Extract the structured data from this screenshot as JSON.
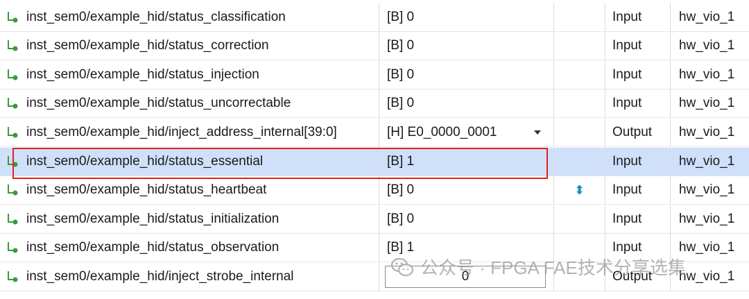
{
  "rows": [
    {
      "name": "inst_sem0/example_hid/status_classification",
      "value": "[B] 0",
      "direction": "Input",
      "vio": "hw_vio_1"
    },
    {
      "name": "inst_sem0/example_hid/status_correction",
      "value": "[B] 0",
      "direction": "Input",
      "vio": "hw_vio_1"
    },
    {
      "name": "inst_sem0/example_hid/status_injection",
      "value": "[B] 0",
      "direction": "Input",
      "vio": "hw_vio_1"
    },
    {
      "name": "inst_sem0/example_hid/status_uncorrectable",
      "value": "[B] 0",
      "direction": "Input",
      "vio": "hw_vio_1"
    },
    {
      "name": "inst_sem0/example_hid/inject_address_internal[39:0]",
      "value": "[H] E0_0000_0001",
      "direction": "Output",
      "vio": "hw_vio_1"
    },
    {
      "name": "inst_sem0/example_hid/status_essential",
      "value": "[B] 1",
      "direction": "Input",
      "vio": "hw_vio_1"
    },
    {
      "name": "inst_sem0/example_hid/status_heartbeat",
      "value": "[B] 0",
      "direction": "Input",
      "vio": "hw_vio_1",
      "activity": "⬍"
    },
    {
      "name": "inst_sem0/example_hid/status_initialization",
      "value": "[B] 0",
      "direction": "Input",
      "vio": "hw_vio_1"
    },
    {
      "name": "inst_sem0/example_hid/status_observation",
      "value": "[B] 1",
      "direction": "Input",
      "vio": "hw_vio_1"
    },
    {
      "name": "inst_sem0/example_hid/inject_strobe_internal",
      "value": "0",
      "direction": "Output",
      "vio": "hw_vio_1"
    }
  ],
  "selected_row": 6,
  "watermark": "公众号 · FPGA FAE技术分享选集",
  "colors": {
    "selection": "#cfe0fa",
    "highlight_border": "#e41e1e",
    "probe_icon": "#3a9a3a"
  }
}
